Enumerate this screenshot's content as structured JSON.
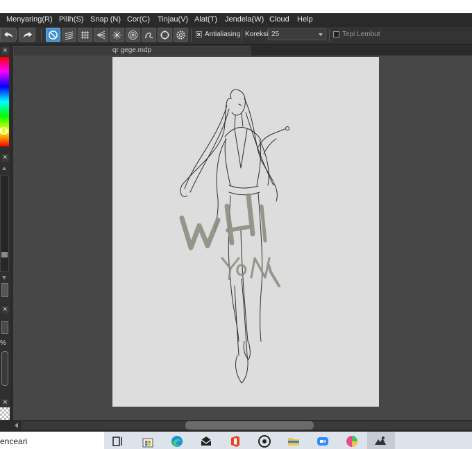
{
  "menu": {
    "items": [
      "Menyaring(R)",
      "Pilih(S)",
      "Snap (N)",
      "Cor(C)",
      "Tinjau(V)",
      "Alat(T)",
      "Jendela(W)",
      "Cloud",
      "Help"
    ]
  },
  "toolbar": {
    "undo_icon": "undo-icon",
    "redo_icon": "redo-icon",
    "snap_tools": [
      "no-snap-icon",
      "parallel-lines-icon",
      "grid-icon",
      "vanishing-point-icon",
      "radial-lines-icon",
      "concentric-circles-icon",
      "curve-icon",
      "ellipse-icon",
      "settings-icon"
    ],
    "antialiasing_label": "Antialiasing",
    "antialiasing_checked": true,
    "correction_label": "Koreksi",
    "correction_value": "25",
    "soft_edge_label": "Tepi Lembut",
    "soft_edge_checked": false,
    "active_color": "#3f8fd6"
  },
  "document": {
    "tab_title": "qr gege.mdp"
  },
  "left_panel": {
    "percent_label": "%"
  },
  "canvas": {
    "watermark_big": "WH",
    "watermark_small": "YON"
  },
  "taskbar": {
    "search_text": "enceari"
  }
}
